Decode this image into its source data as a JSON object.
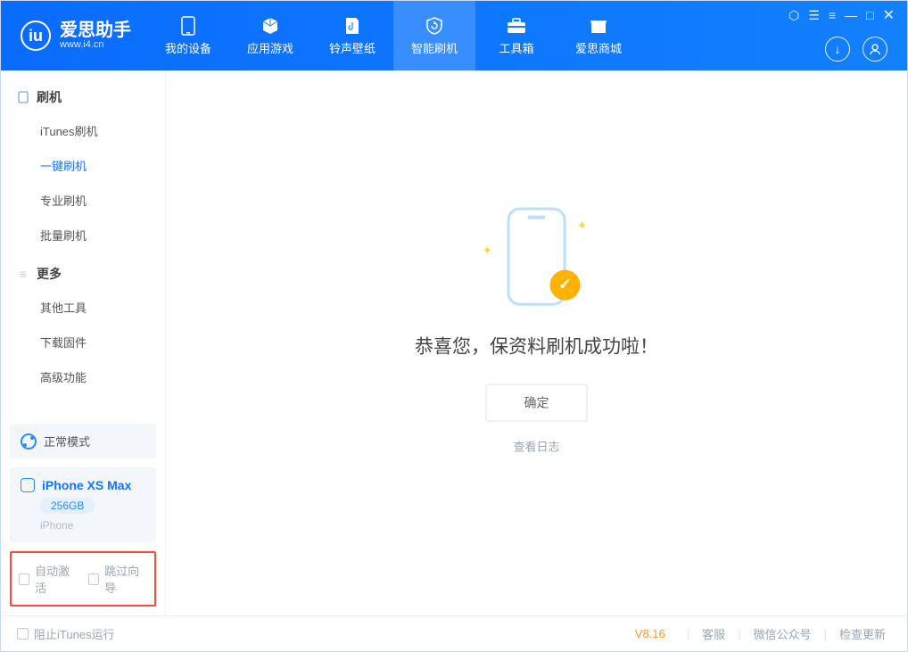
{
  "app": {
    "name": "爱思助手",
    "url": "www.i4.cn",
    "logo_letter": "iu"
  },
  "tabs": [
    {
      "label": "我的设备"
    },
    {
      "label": "应用游戏"
    },
    {
      "label": "铃声壁纸"
    },
    {
      "label": "智能刷机"
    },
    {
      "label": "工具箱"
    },
    {
      "label": "爱思商城"
    }
  ],
  "sidebar": {
    "group1": {
      "title": "刷机",
      "items": [
        {
          "label": "iTunes刷机"
        },
        {
          "label": "一键刷机"
        },
        {
          "label": "专业刷机"
        },
        {
          "label": "批量刷机"
        }
      ]
    },
    "group2": {
      "title": "更多",
      "items": [
        {
          "label": "其他工具"
        },
        {
          "label": "下载固件"
        },
        {
          "label": "高级功能"
        }
      ]
    },
    "mode": {
      "label": "正常模式"
    },
    "device": {
      "name": "iPhone XS Max",
      "capacity": "256GB",
      "type": "iPhone"
    },
    "options": {
      "auto_activate": "自动激活",
      "skip_guide": "跳过向导"
    }
  },
  "main": {
    "success_msg": "恭喜您，保资料刷机成功啦！",
    "ok": "确定",
    "view_log": "查看日志"
  },
  "footer": {
    "block_itunes": "阻止iTunes运行",
    "version": "V8.16",
    "support": "客服",
    "wechat": "微信公众号",
    "check_update": "检查更新"
  }
}
